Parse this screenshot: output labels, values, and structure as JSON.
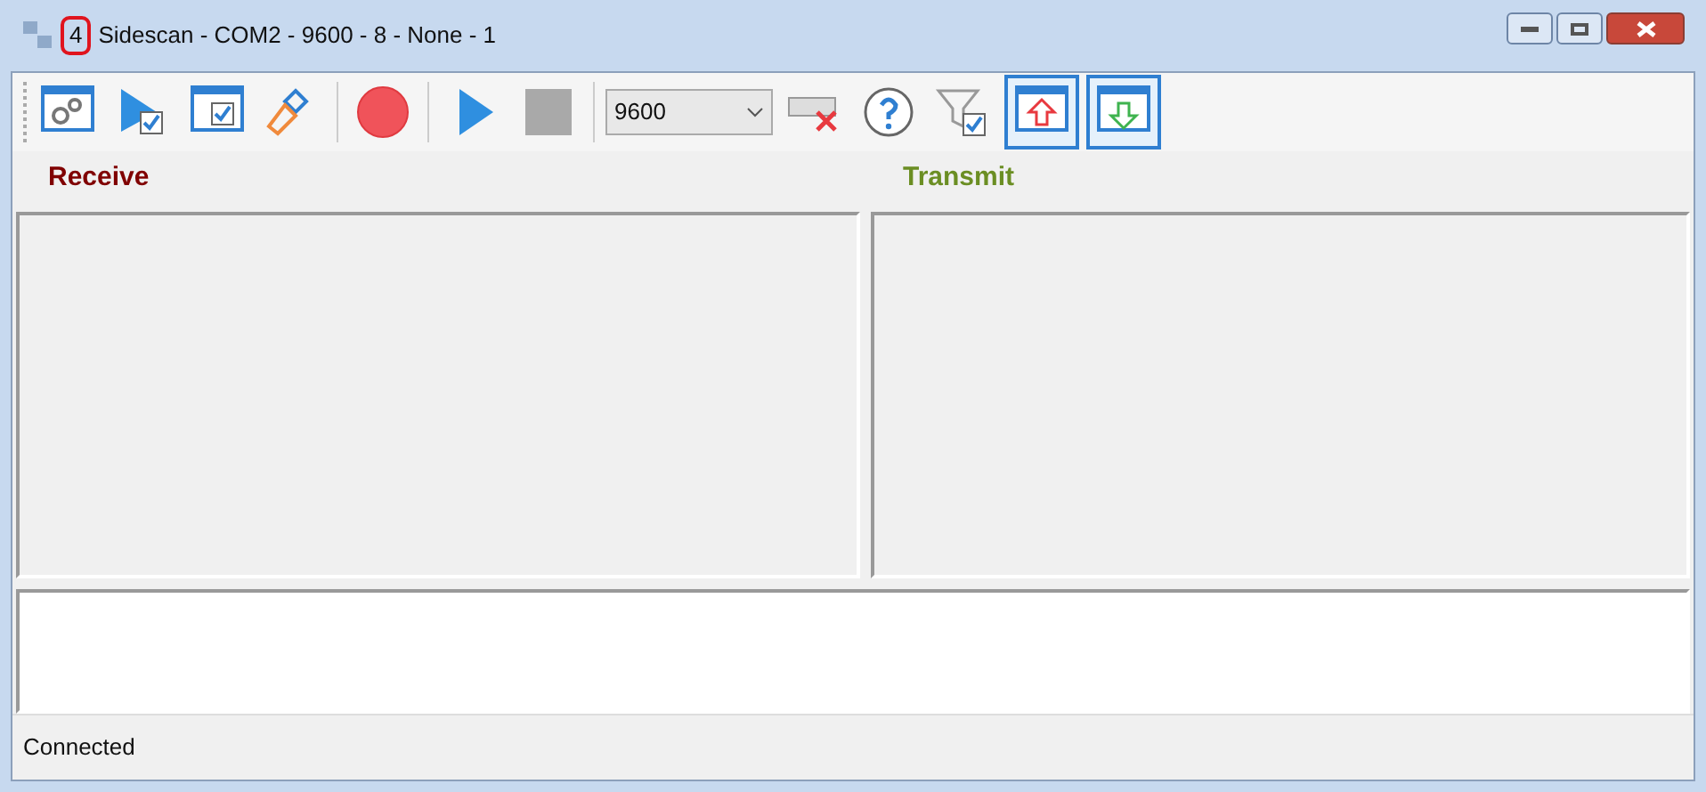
{
  "window": {
    "badge": "4",
    "title": "Sidescan - COM2 - 9600 - 8 - None - 1"
  },
  "toolbar": [
    {
      "kind": "button",
      "pressed": false
    },
    {
      "kind": "button",
      "pressed": false
    },
    {
      "kind": "button",
      "pressed": false
    },
    {
      "kind": "button",
      "pressed": false
    },
    {
      "kind": "separator"
    },
    {
      "kind": "button",
      "pressed": false
    },
    {
      "kind": "separator"
    },
    {
      "kind": "button",
      "pressed": false
    },
    {
      "kind": "button",
      "pressed": false
    },
    {
      "kind": "separator"
    },
    {
      "kind": "combo",
      "value": "9600"
    },
    {
      "kind": "button",
      "pressed": false
    },
    {
      "kind": "button",
      "pressed": false
    },
    {
      "kind": "button",
      "pressed": false
    },
    {
      "kind": "button",
      "pressed": true
    },
    {
      "kind": "button",
      "pressed": true
    }
  ],
  "panes": [
    {
      "label": "Receive",
      "color": "#800000"
    },
    {
      "label": "Transmit",
      "color": "#6b8e23"
    }
  ],
  "status_bar": "Connected"
}
